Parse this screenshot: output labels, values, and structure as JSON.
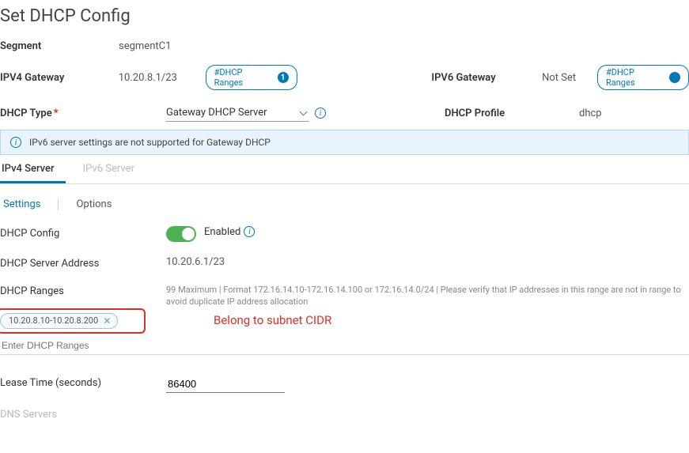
{
  "header": {
    "title": "Set DHCP Config"
  },
  "segment": {
    "label": "Segment",
    "value": "segmentC1"
  },
  "ipv4_gateway": {
    "label": "IPV4 Gateway",
    "value": "10.20.8.1/23",
    "chip_label": "#DHCP Ranges",
    "chip_count": "1"
  },
  "ipv6_gateway": {
    "label": "IPV6 Gateway",
    "value": "Not Set",
    "chip_label": "#DHCP Ranges"
  },
  "dhcp_type": {
    "label": "DHCP Type",
    "value": "Gateway DHCP Server"
  },
  "dhcp_profile": {
    "label": "DHCP Profile",
    "value": "dhcp"
  },
  "alert": {
    "text": "IPv6 server settings are not supported for Gateway DHCP"
  },
  "tabs": {
    "ipv4": "IPv4 Server",
    "ipv6": "IPv6 Server"
  },
  "subtabs": {
    "settings": "Settings",
    "options": "Options"
  },
  "dhcp_config": {
    "label": "DHCP Config",
    "enabled_text": "Enabled"
  },
  "server_addr": {
    "label": "DHCP Server Address",
    "value": "10.20.6.1/23"
  },
  "ranges": {
    "label": "DHCP Ranges",
    "hint": "99 Maximum | Format 172.16.14.10-172.16.14.100 or 172.16.14.0/24 | Please verify that IP addresses in this range are not in range to avoid duplicate IP address allocation",
    "chip": "10.20.8.10-10.20.8.200",
    "placeholder": "Enter DHCP Ranges",
    "annotation": "Belong to subnet CIDR"
  },
  "lease": {
    "label": "Lease Time (seconds)",
    "value": "86400"
  },
  "dns": {
    "label": "DNS Servers"
  }
}
